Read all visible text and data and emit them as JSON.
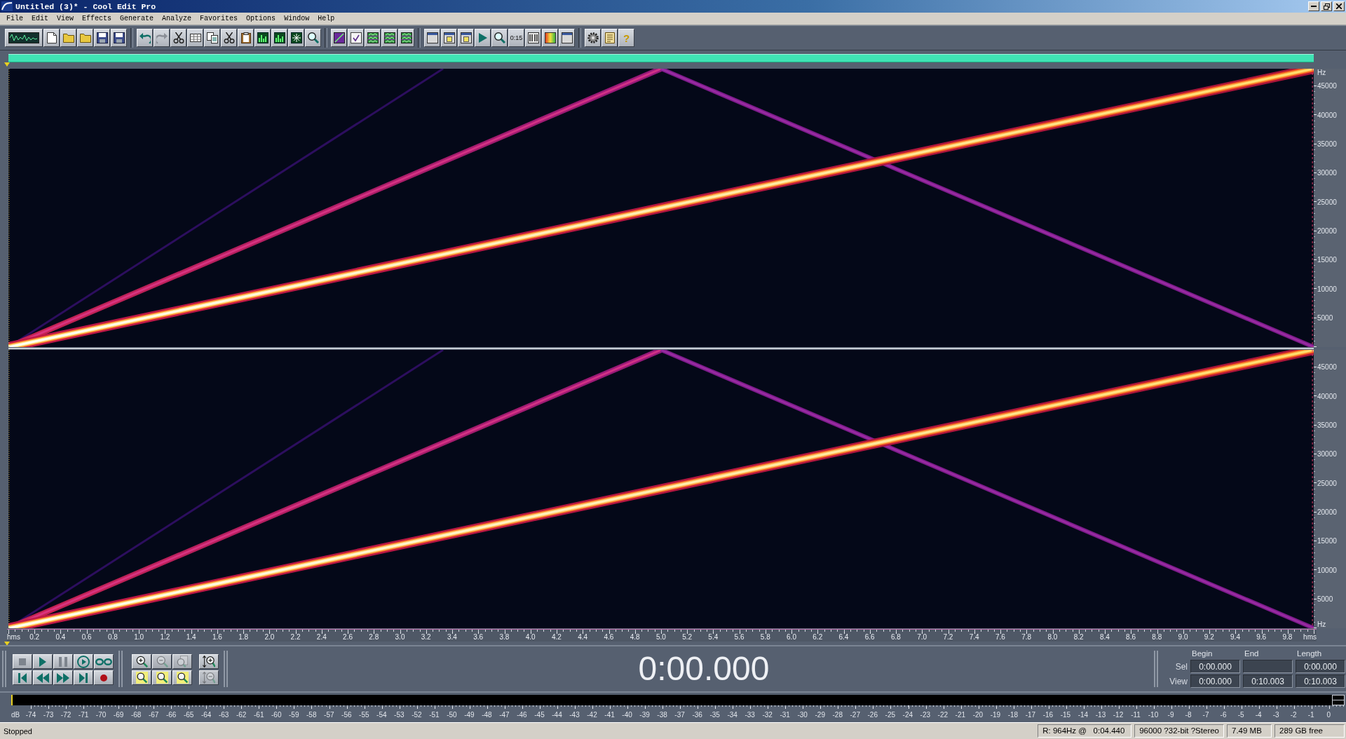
{
  "window": {
    "title": "Untitled (3)* - Cool Edit Pro"
  },
  "menu": [
    "File",
    "Edit",
    "View",
    "Effects",
    "Generate",
    "Analyze",
    "Favorites",
    "Options",
    "Window",
    "Help"
  ],
  "toolbar": {
    "clock_label": "0:15",
    "help_label": "?"
  },
  "channels": [
    {
      "top_label": "Hz",
      "freq_ticks": [
        "45000",
        "40000",
        "35000",
        "30000",
        "25000",
        "20000",
        "15000",
        "10000",
        "5000"
      ]
    },
    {
      "freq_ticks": [
        "45000",
        "40000",
        "35000",
        "30000",
        "25000",
        "20000",
        "15000",
        "10000",
        "5000"
      ],
      "bottom_label": "Hz"
    }
  ],
  "time_axis": {
    "unit_left": "hms",
    "ticks": [
      "0.2",
      "0.4",
      "0.6",
      "0.8",
      "1.0",
      "1.2",
      "1.4",
      "1.6",
      "1.8",
      "2.0",
      "2.2",
      "2.4",
      "2.6",
      "2.8",
      "3.0",
      "3.2",
      "3.4",
      "3.6",
      "3.8",
      "4.0",
      "4.2",
      "4.4",
      "4.6",
      "4.8",
      "5.0",
      "5.2",
      "5.4",
      "5.6",
      "5.8",
      "6.0",
      "6.2",
      "6.4",
      "6.6",
      "6.8",
      "7.0",
      "7.2",
      "7.4",
      "7.6",
      "7.8",
      "8.0",
      "8.2",
      "8.4",
      "8.6",
      "8.8",
      "9.0",
      "9.2",
      "9.4",
      "9.6",
      "9.8"
    ],
    "unit_right": "hms"
  },
  "zoom_buttons": [
    {
      "kind": "in",
      "disabled": false
    },
    {
      "kind": "out",
      "disabled": true
    },
    {
      "kind": "full",
      "disabled": true
    },
    {
      "kind": "vin",
      "disabled": false
    },
    {
      "kind": "left",
      "disabled": false
    },
    {
      "kind": "right",
      "disabled": false
    },
    {
      "kind": "selection",
      "disabled": false
    },
    {
      "kind": "vout",
      "disabled": true
    }
  ],
  "time_display": "0:00.000",
  "selection": {
    "columns": [
      "Begin",
      "End",
      "Length"
    ],
    "rows": [
      {
        "label": "Sel",
        "begin": "0:00.000",
        "length": "0:00.000"
      },
      {
        "label": "View",
        "begin": "0:00.000",
        "end": "0:10.003",
        "length": "0:10.003"
      }
    ]
  },
  "level_meter": {
    "unit": "dB",
    "ticks": [
      "-74",
      "-73",
      "-72",
      "-71",
      "-70",
      "-69",
      "-68",
      "-67",
      "-66",
      "-65",
      "-64",
      "-63",
      "-62",
      "-61",
      "-60",
      "-59",
      "-58",
      "-57",
      "-56",
      "-55",
      "-54",
      "-53",
      "-52",
      "-51",
      "-50",
      "-49",
      "-48",
      "-47",
      "-46",
      "-45",
      "-44",
      "-43",
      "-42",
      "-41",
      "-40",
      "-39",
      "-38",
      "-37",
      "-36",
      "-35",
      "-34",
      "-33",
      "-32",
      "-31",
      "-30",
      "-29",
      "-28",
      "-27",
      "-26",
      "-25",
      "-24",
      "-23",
      "-22",
      "-21",
      "-20",
      "-19",
      "-18",
      "-17",
      "-16",
      "-15",
      "-14",
      "-13",
      "-12",
      "-11",
      "-10",
      "-9",
      "-8",
      "-7",
      "-6",
      "-5",
      "-4",
      "-3",
      "-2",
      "-1",
      "0"
    ]
  },
  "status_bar": {
    "state": "Stopped",
    "fields": [
      "R: 964Hz @   0:04.440",
      "96000 ?32-bit ?Stereo",
      "7.49 MB",
      "289 GB free"
    ]
  }
}
